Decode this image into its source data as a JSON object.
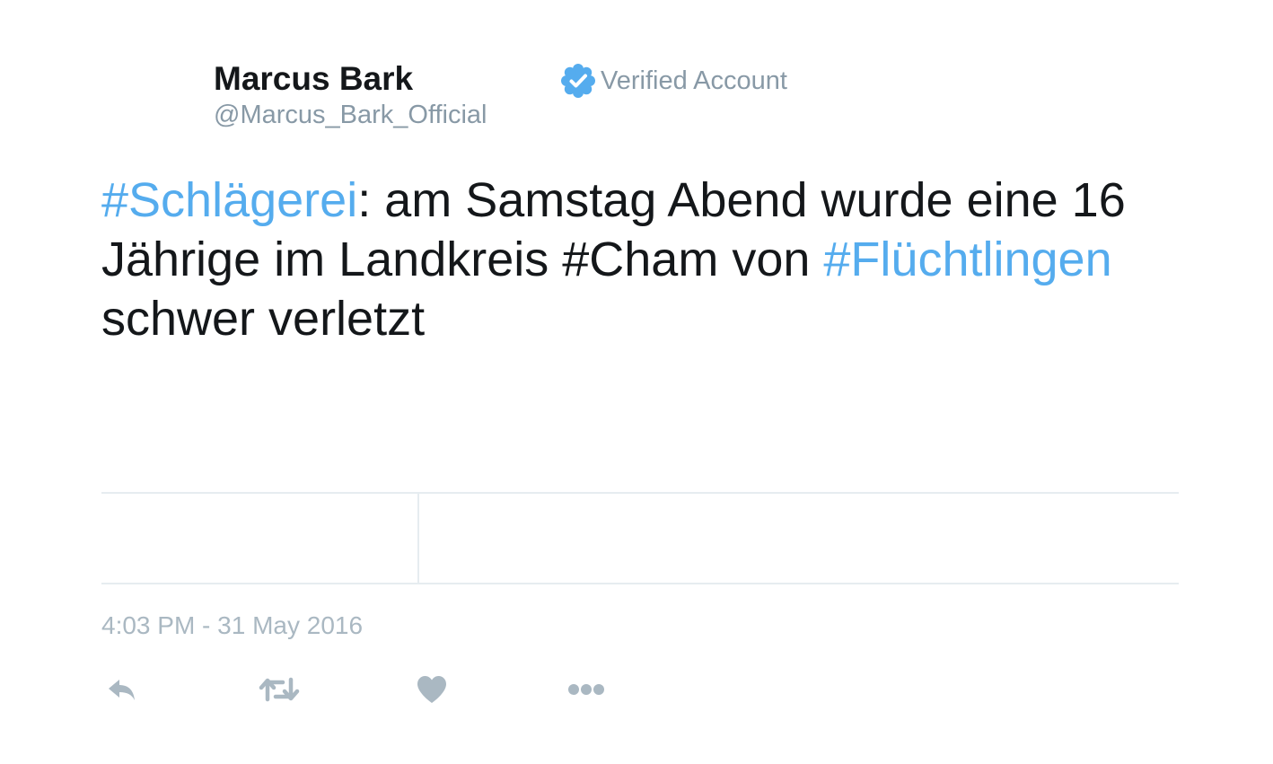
{
  "author": {
    "name": "Marcus Bark",
    "handle": "@Marcus_Bark_Official"
  },
  "verified": {
    "label": "Verified Account",
    "icon": "verified-badge-icon",
    "color": "#55acee"
  },
  "tweet": {
    "segments": [
      {
        "text": "#Schlägerei",
        "type": "hashtag"
      },
      {
        "text": ": am Samstag Abend wurde eine 16 Jährige im Landkreis #Cham von ",
        "type": "text"
      },
      {
        "text": "#Flüchtlingen",
        "type": "hashtag"
      },
      {
        "text": " schwer verletzt",
        "type": "text"
      }
    ]
  },
  "timestamp": "4:03 PM - 31 May 2016",
  "actions": [
    {
      "name": "reply",
      "icon": "reply-icon"
    },
    {
      "name": "retweet",
      "icon": "retweet-icon"
    },
    {
      "name": "like",
      "icon": "heart-icon"
    },
    {
      "name": "more",
      "icon": "more-dots-icon"
    }
  ],
  "colors": {
    "text": "#14171a",
    "hashtag": "#55acee",
    "secondary": "#8899a6",
    "muted": "#aab8c2",
    "divider": "#e6ecf0"
  }
}
